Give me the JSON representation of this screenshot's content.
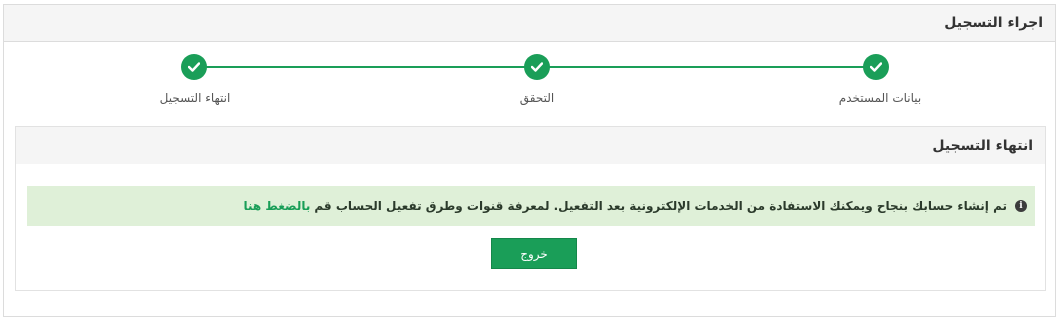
{
  "header": {
    "title": "اجراء التسجيل"
  },
  "steps": [
    {
      "label": "بيانات المستخدم",
      "status": "completed",
      "icon": "check-icon"
    },
    {
      "label": "التحقق",
      "status": "completed",
      "icon": "check-icon"
    },
    {
      "label": "انتهاء التسجيل",
      "status": "completed",
      "icon": "check-icon"
    }
  ],
  "section": {
    "title": "انتهاء التسجيل",
    "alert": {
      "icon": "info-icon",
      "text": "تم إنشاء حسابك بنجاح ويمكنك الاستفادة من الخدمات الإلكترونية بعد التفعيل. لمعرفة قنوات وطرق تفعيل الحساب قم",
      "link_text": "بالضغط هنا"
    },
    "exit_button": "خروج"
  },
  "colors": {
    "accent": "#1a9e58",
    "alert_bg": "#dff0d8",
    "header_bg": "#f5f5f5"
  }
}
